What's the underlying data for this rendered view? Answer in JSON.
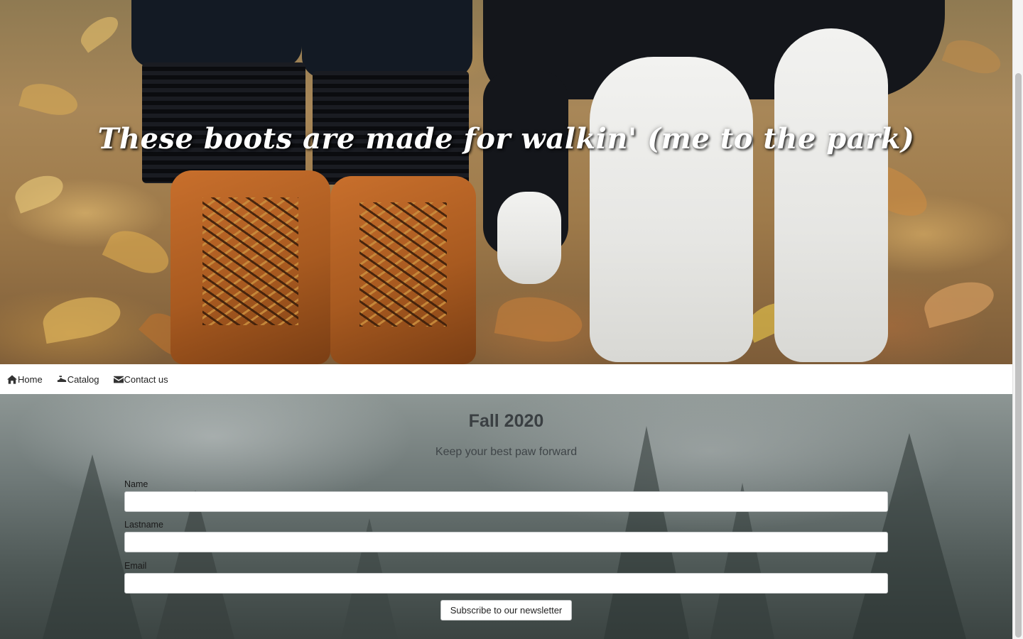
{
  "hero": {
    "title": "These boots are made for walkin' (me to the park)"
  },
  "nav": {
    "items": [
      {
        "label": "Home",
        "icon": "home-icon"
      },
      {
        "label": "Catalog",
        "icon": "shoe-icon"
      },
      {
        "label": "Contact us",
        "icon": "envelope-icon"
      }
    ]
  },
  "main": {
    "title": "Fall 2020",
    "subtitle": "Keep your best paw forward",
    "form": {
      "name_label": "Name",
      "name_value": "",
      "lastname_label": "Lastname",
      "lastname_value": "",
      "email_label": "Email",
      "email_value": "",
      "submit_label": "Subscribe to our newsletter"
    }
  }
}
